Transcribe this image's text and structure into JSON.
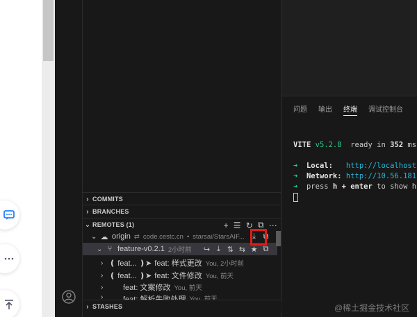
{
  "sidebar": {
    "commits_label": "COMMITS",
    "branches_label": "BRANCHES",
    "remotes_label": "REMOTES (1)",
    "stashes_label": "STASHES",
    "remote": {
      "name": "origin",
      "host": "code.cestc.cn",
      "repo": "starsai/StarsAIF..."
    },
    "branch": {
      "name": "feature-v0.2.1",
      "time": "2小时前"
    },
    "commits": [
      {
        "tag": "❪ feat... ❫➤",
        "message": "feat: 样式更改",
        "meta": "You, 2小时前"
      },
      {
        "tag": "❪ feat... ❫➤",
        "message": "feat: 文件修改",
        "meta": "You, 前天"
      },
      {
        "tag": "",
        "message": "feat: 文案修改",
        "meta": "You, 前天"
      },
      {
        "tag": "",
        "message": "feat: 解析失败处理",
        "meta": "You, 前天"
      }
    ]
  },
  "panel": {
    "tabs": [
      "问题",
      "输出",
      "终端",
      "调试控制台"
    ],
    "active_tab": "终端"
  },
  "terminal": {
    "vite": "VITE",
    "version": "v5.2.8",
    "ready_prefix": "ready in ",
    "ready_time": "352",
    "ready_unit": " ms",
    "local_label": "Local:",
    "local_url": "http://localhost",
    "network_label": "Network:",
    "network_url": "http://10.56.181",
    "help_prefix": "press ",
    "help_key": "h + enter",
    "help_suffix": " to show h"
  },
  "watermark": "@稀土掘金技术社区",
  "colors": {
    "accent_green": "#23d18b",
    "link_cyan": "#29b8db",
    "highlight_red": "#e01b1b"
  }
}
